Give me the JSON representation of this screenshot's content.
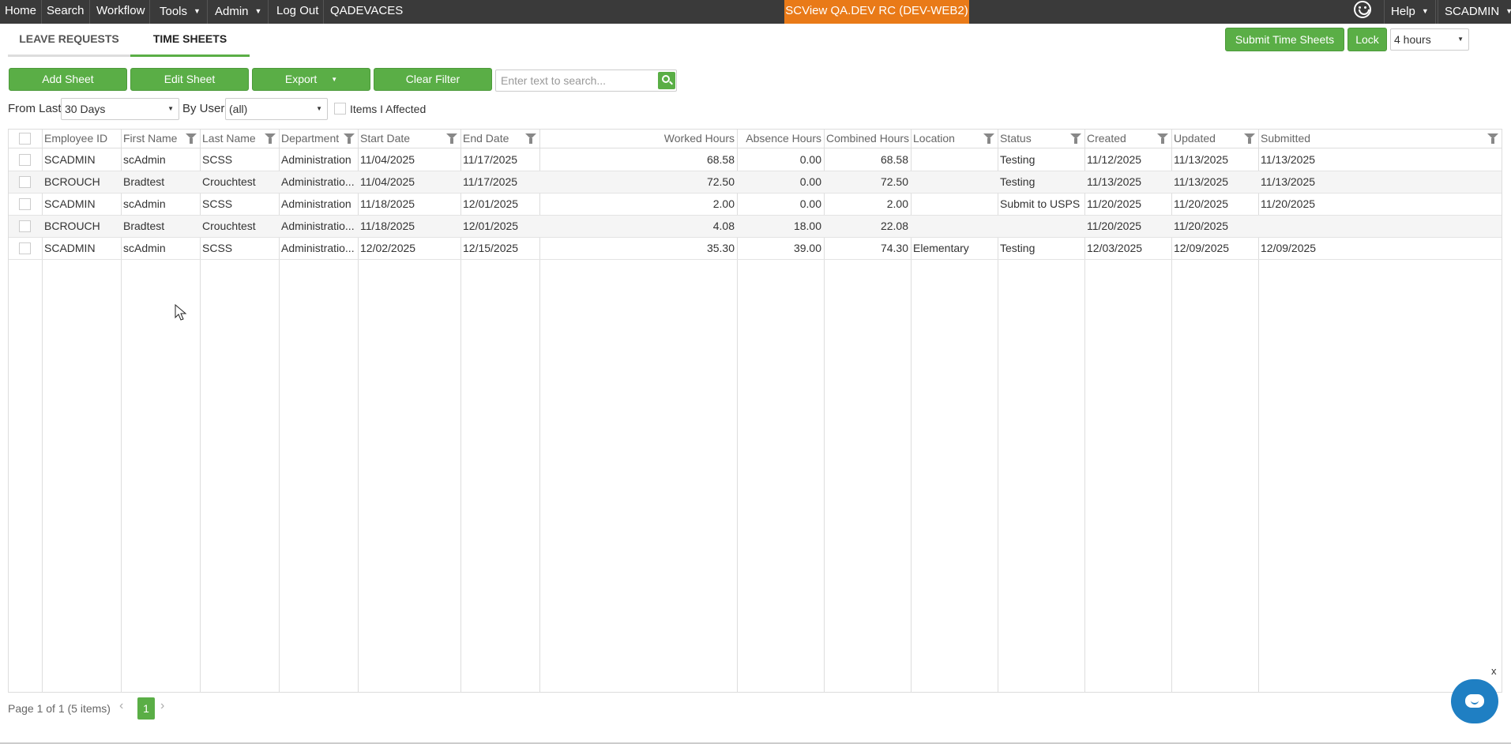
{
  "topnav": {
    "items": [
      "Home",
      "Search",
      "Workflow",
      "Tools",
      "Admin",
      "Log Out",
      "QADEVACES"
    ],
    "env_badge": "SCView QA.DEV RC (DEV-WEB2)",
    "help": "Help",
    "user": "SCADMIN",
    "brand_color": "#e97a18"
  },
  "tabs": [
    "LEAVE REQUESTS",
    "TIME SHEETS"
  ],
  "actions": {
    "submit_label": "Submit Time Sheets",
    "lock_label": "Lock",
    "lock_duration": "4 hours"
  },
  "toolbar": {
    "add": "Add Sheet",
    "edit": "Edit Sheet",
    "export": "Export",
    "clear": "Clear Filter",
    "search_placeholder": "Enter text to search..."
  },
  "filters": {
    "from_last_label": "From Last",
    "from_last_value": "30 Days",
    "by_user_label": "By User",
    "by_user_value": "(all)",
    "items_affected_label": "Items I Affected"
  },
  "table": {
    "columns": [
      "Employee ID",
      "First Name",
      "Last Name",
      "Department",
      "Start Date",
      "End Date",
      "Worked Hours",
      "Absence Hours",
      "Combined Hours",
      "Location",
      "Status",
      "Created",
      "Updated",
      "Submitted"
    ],
    "rows": [
      [
        "SCADMIN",
        "scAdmin",
        "SCSS",
        "Administration",
        "11/04/2025",
        "11/17/2025",
        "68.58",
        "0.00",
        "68.58",
        "",
        "Testing",
        "11/12/2025",
        "11/13/2025",
        "11/13/2025"
      ],
      [
        "BCROUCH",
        "Bradtest",
        "Crouchtest",
        "Administratio...",
        "11/04/2025",
        "11/17/2025",
        "72.50",
        "0.00",
        "72.50",
        "",
        "Testing",
        "11/13/2025",
        "11/13/2025",
        "11/13/2025"
      ],
      [
        "SCADMIN",
        "scAdmin",
        "SCSS",
        "Administration",
        "11/18/2025",
        "12/01/2025",
        "2.00",
        "0.00",
        "2.00",
        "",
        "Submit to USPS",
        "11/20/2025",
        "11/20/2025",
        "11/20/2025"
      ],
      [
        "BCROUCH",
        "Bradtest",
        "Crouchtest",
        "Administratio...",
        "11/18/2025",
        "12/01/2025",
        "4.08",
        "18.00",
        "22.08",
        "",
        "",
        "11/20/2025",
        "11/20/2025",
        ""
      ],
      [
        "SCADMIN",
        "scAdmin",
        "SCSS",
        "Administratio...",
        "12/02/2025",
        "12/15/2025",
        "35.30",
        "39.00",
        "74.30",
        "Elementary",
        "Testing",
        "12/03/2025",
        "12/09/2025",
        "12/09/2025"
      ]
    ]
  },
  "pager": {
    "summary": "Page 1 of 1 (5 items)",
    "current_page": "1"
  },
  "chat": {
    "close_label": "x"
  }
}
